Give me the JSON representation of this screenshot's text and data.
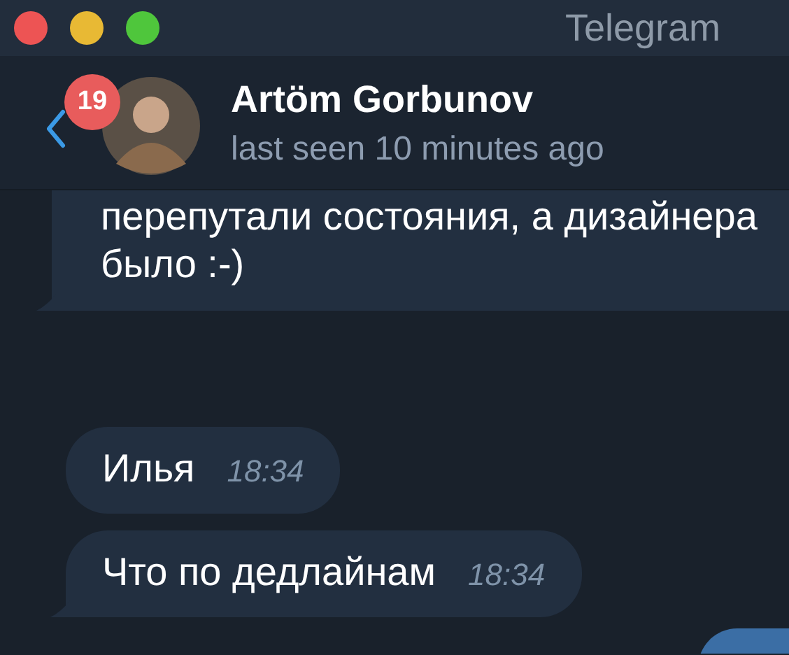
{
  "window": {
    "title": "Telegram"
  },
  "header": {
    "unread_badge": "19",
    "name": "Artöm Gorbunov",
    "status": "last seen 10 minutes ago"
  },
  "messages": [
    {
      "kind": "incoming",
      "lines": [
        "перепутали состояния, а дизайнера",
        "было :-)"
      ],
      "tail": true
    },
    {
      "kind": "incoming",
      "text": "Илья",
      "time": "18:34",
      "tail": false
    },
    {
      "kind": "incoming",
      "text": "Что по дедлайнам",
      "time": "18:34",
      "tail": true
    },
    {
      "kind": "outgoing"
    }
  ]
}
